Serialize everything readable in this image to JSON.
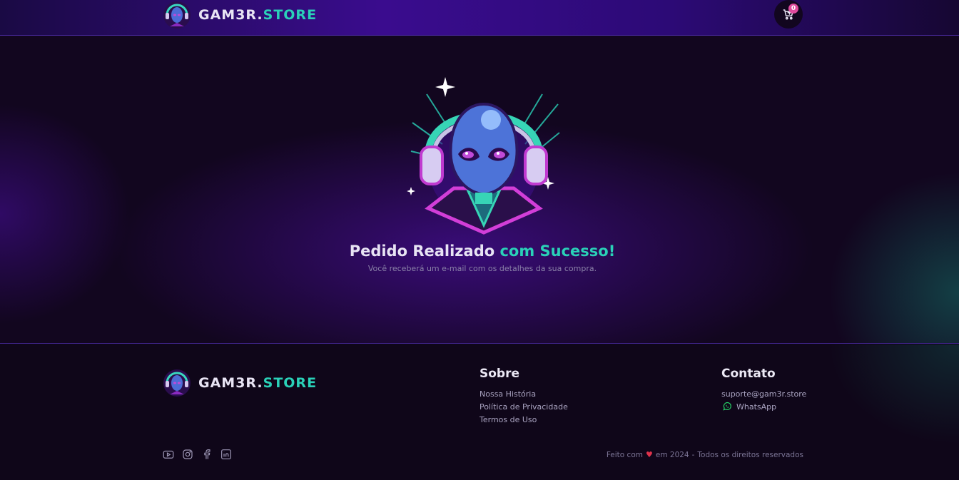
{
  "header": {
    "brand": {
      "part1": "GAM3R.",
      "part2": "STORE"
    },
    "cart": {
      "count": "0"
    }
  },
  "main": {
    "title": {
      "part1": "Pedido Realizado ",
      "part2": "com Sucesso!"
    },
    "subtitle": "Você receberá um e-mail com os detalhes da sua compra."
  },
  "footer": {
    "brand": {
      "part1": "GAM3R.",
      "part2": "STORE"
    },
    "sobre": {
      "title": "Sobre",
      "links": [
        "Nossa História",
        "Política de Privacidade",
        "Termos de Uso"
      ]
    },
    "contato": {
      "title": "Contato",
      "email": "suporte@gam3r.store",
      "whatsapp": "WhatsApp"
    },
    "social_icons": [
      "youtube-icon",
      "instagram-icon",
      "facebook-icon",
      "linkedin-icon"
    ],
    "credits": {
      "made_with": "Feito com",
      "year": "em 2024",
      "separator": "-",
      "rights": "Todos os direitos reservados"
    }
  },
  "colors": {
    "accent_teal": "#2ad1b8",
    "header_purple": "#3a0c8e",
    "badge_pink": "#e04a9e",
    "heart_red": "#e0324b"
  }
}
